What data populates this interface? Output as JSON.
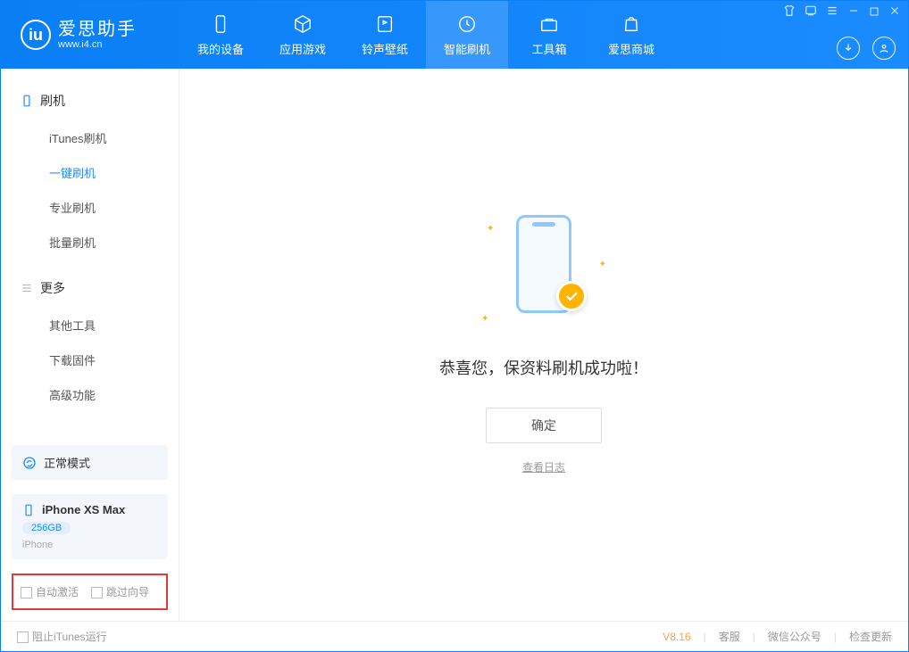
{
  "logo": {
    "main": "爱思助手",
    "sub": "www.i4.cn"
  },
  "nav": [
    {
      "label": "我的设备",
      "icon": "device"
    },
    {
      "label": "应用游戏",
      "icon": "cube"
    },
    {
      "label": "铃声壁纸",
      "icon": "music"
    },
    {
      "label": "智能刷机",
      "icon": "shield",
      "active": true
    },
    {
      "label": "工具箱",
      "icon": "toolbox"
    },
    {
      "label": "爱思商城",
      "icon": "bag"
    }
  ],
  "sidebar": {
    "groups": [
      {
        "title": "刷机",
        "icon": "phone",
        "items": [
          {
            "label": "iTunes刷机"
          },
          {
            "label": "一键刷机",
            "active": true
          },
          {
            "label": "专业刷机"
          },
          {
            "label": "批量刷机"
          }
        ]
      },
      {
        "title": "更多",
        "icon": "more",
        "items": [
          {
            "label": "其他工具"
          },
          {
            "label": "下载固件"
          },
          {
            "label": "高级功能"
          }
        ]
      }
    ],
    "mode_label": "正常模式",
    "device": {
      "name": "iPhone XS Max",
      "storage": "256GB",
      "type": "iPhone"
    },
    "auto_activate": "自动激活",
    "skip_guide": "跳过向导"
  },
  "main": {
    "success_msg": "恭喜您，保资料刷机成功啦！",
    "ok_label": "确定",
    "log_label": "查看日志"
  },
  "footer": {
    "block_itunes": "阻止iTunes运行",
    "version": "V8.16",
    "links": [
      "客服",
      "微信公众号",
      "检查更新"
    ]
  }
}
